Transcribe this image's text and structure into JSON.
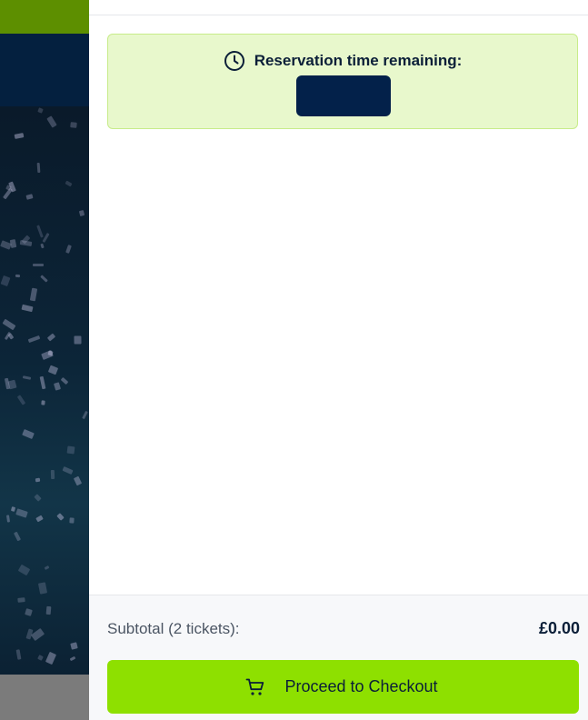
{
  "reservation": {
    "label": "Reservation time remaining:",
    "timer_value": "",
    "icon": "clock-icon"
  },
  "footer": {
    "subtotal_label": "Subtotal (2 tickets):",
    "subtotal_value": "£0.00",
    "checkout_label": "Proceed to Checkout",
    "checkout_icon": "cart-icon"
  },
  "colors": {
    "accent_green": "#8ee000",
    "reservation_bg": "#e8f8cc",
    "navy": "#03214a",
    "text_dark": "#0b1f38"
  }
}
